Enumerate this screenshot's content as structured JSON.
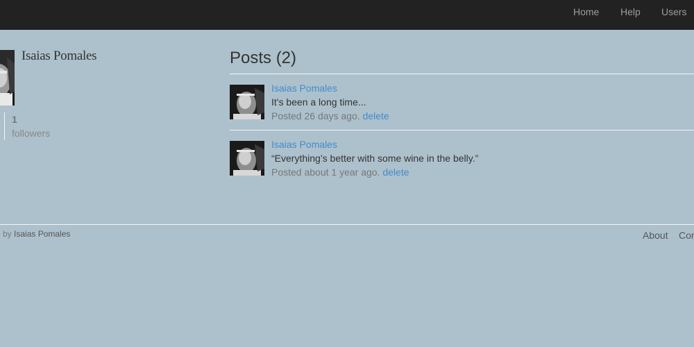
{
  "nav": {
    "home": "Home",
    "help": "Help",
    "users": "Users"
  },
  "profile": {
    "name": "Isaias Pomales",
    "followers_count": "1",
    "followers_label": "followers"
  },
  "posts": {
    "title": "Posts (2)",
    "items": [
      {
        "user": "Isaias Pomales",
        "content": "It's been a long time...",
        "timestamp": "Posted 26 days ago.",
        "delete_label": "delete"
      },
      {
        "user": "Isaias Pomales",
        "content": "“Everything’s better with some wine in the belly.”",
        "timestamp": "Posted about 1 year ago.",
        "delete_label": "delete"
      }
    ]
  },
  "footer": {
    "credit_prefix": "p by",
    "credit_author": "Isaias Pomales",
    "about": "About",
    "contact": "Cor"
  },
  "colors": {
    "background": "#adc1cc",
    "navbar": "#222222",
    "link": "#428bca"
  }
}
